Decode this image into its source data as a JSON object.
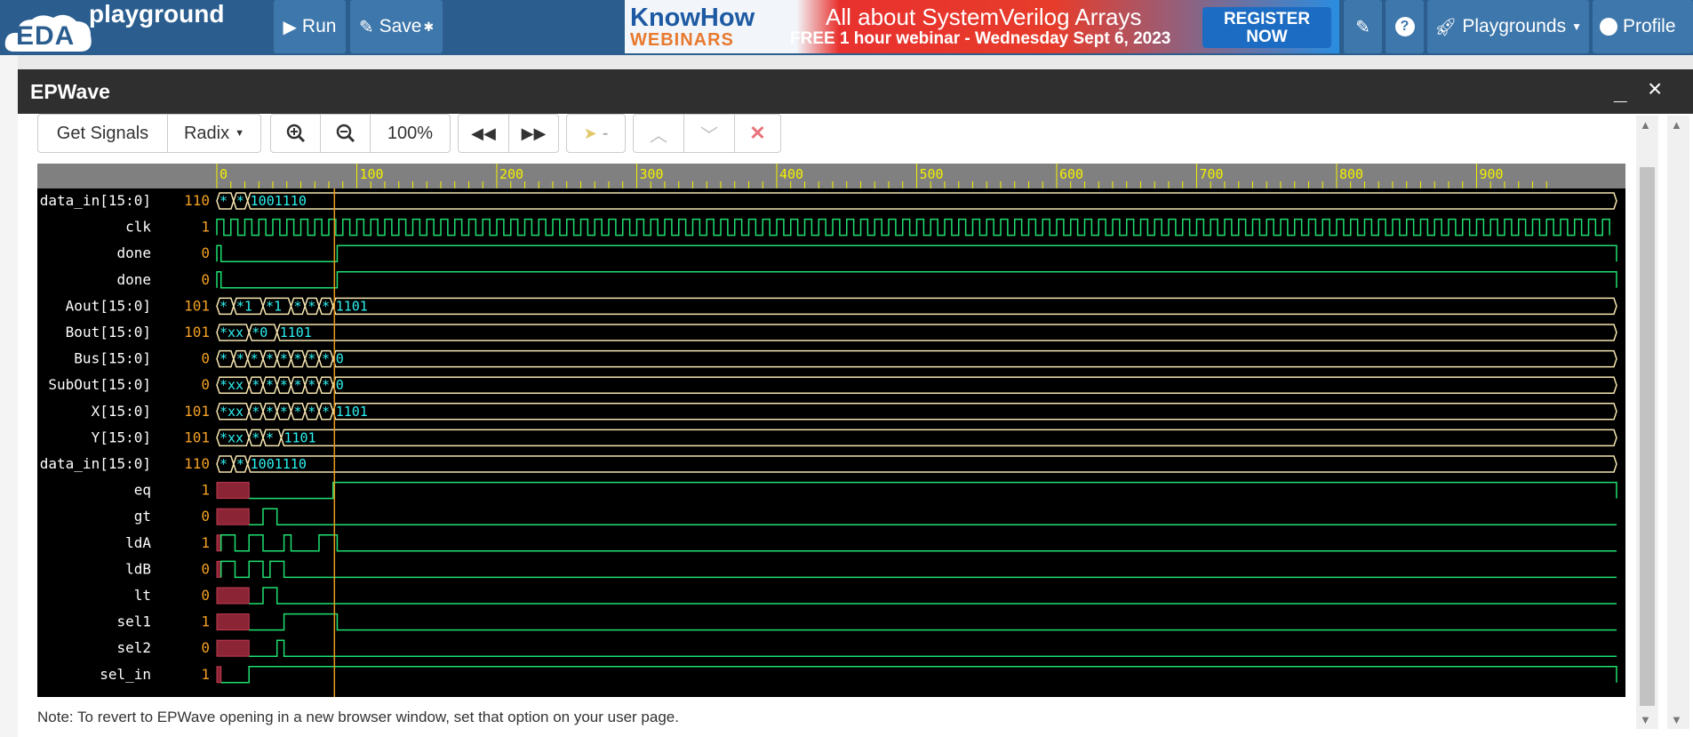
{
  "navbar": {
    "logo_eda": "EDA",
    "logo_playground": "playground",
    "run_label": "Run",
    "save_label": "Save",
    "save_marker": "✱",
    "playgrounds_label": "Playgrounds",
    "profile_label": "Profile"
  },
  "banner": {
    "brand_line1": "KnowHow",
    "brand_line2": "WEBINARS",
    "headline": "All about SystemVerilog Arrays",
    "subline": "FREE 1 hour webinar - Wednesday Sept 6, 2023",
    "cta_line1": "REGISTER",
    "cta_line2": "NOW"
  },
  "modal": {
    "title": "EPWave",
    "minimize": "_",
    "close": "×"
  },
  "toolbar": {
    "get_signals": "Get Signals",
    "radix": "Radix",
    "zoom_level": "100%",
    "cursor_value": "-"
  },
  "timeline": {
    "ticks": [
      "0",
      "100",
      "200",
      "300",
      "400",
      "500",
      "600",
      "700",
      "800",
      "900"
    ]
  },
  "signals": [
    {
      "name": "data_in[15:0]",
      "value": "110",
      "type": "bus",
      "segs": [
        [
          "*",
          0,
          12
        ],
        [
          "*",
          12,
          22
        ],
        [
          "1001110",
          22,
          1000
        ]
      ]
    },
    {
      "name": "clk",
      "value": "1",
      "type": "clk"
    },
    {
      "name": "done",
      "value": "0",
      "type": "bit",
      "high": [
        [
          0,
          3
        ],
        [
          86,
          1000
        ]
      ]
    },
    {
      "name": "done",
      "value": "0",
      "type": "bit",
      "high": [
        [
          0,
          3
        ],
        [
          86,
          1000
        ]
      ]
    },
    {
      "name": "Aout[15:0]",
      "value": "101",
      "type": "bus",
      "segs": [
        [
          "*",
          0,
          12
        ],
        [
          "*1",
          12,
          33
        ],
        [
          "*1",
          33,
          53
        ],
        [
          "*",
          53,
          63
        ],
        [
          "*",
          63,
          73
        ],
        [
          "*",
          73,
          83
        ],
        [
          "1101",
          83,
          1000
        ]
      ]
    },
    {
      "name": "Bout[15:0]",
      "value": "101",
      "type": "bus",
      "segs": [
        [
          "*xx",
          0,
          23
        ],
        [
          "*0",
          23,
          43
        ],
        [
          "1101",
          43,
          1000
        ]
      ]
    },
    {
      "name": "Bus[15:0]",
      "value": "0",
      "type": "bus",
      "segs": [
        [
          "*",
          0,
          12
        ],
        [
          "*",
          12,
          22
        ],
        [
          "*",
          22,
          33
        ],
        [
          "*",
          33,
          43
        ],
        [
          "*",
          43,
          53
        ],
        [
          "*",
          53,
          63
        ],
        [
          "*",
          63,
          73
        ],
        [
          "*",
          73,
          83
        ],
        [
          "0",
          83,
          1000
        ]
      ]
    },
    {
      "name": "SubOut[15:0]",
      "value": "0",
      "type": "bus",
      "segs": [
        [
          "*xx",
          0,
          23
        ],
        [
          "*",
          23,
          33
        ],
        [
          "*",
          33,
          43
        ],
        [
          "*",
          43,
          53
        ],
        [
          "*",
          53,
          63
        ],
        [
          "*",
          63,
          73
        ],
        [
          "*",
          73,
          83
        ],
        [
          "0",
          83,
          1000
        ]
      ]
    },
    {
      "name": "X[15:0]",
      "value": "101",
      "type": "bus",
      "segs": [
        [
          "*xx",
          0,
          23
        ],
        [
          "*",
          23,
          33
        ],
        [
          "*",
          33,
          43
        ],
        [
          "*",
          43,
          53
        ],
        [
          "*",
          53,
          63
        ],
        [
          "*",
          63,
          73
        ],
        [
          "*",
          73,
          83
        ],
        [
          "1101",
          83,
          1000
        ]
      ]
    },
    {
      "name": "Y[15:0]",
      "value": "101",
      "type": "bus",
      "segs": [
        [
          "*xx",
          0,
          23
        ],
        [
          "*",
          23,
          33
        ],
        [
          "*",
          33,
          46
        ],
        [
          "1101",
          46,
          1000
        ]
      ]
    },
    {
      "name": "data_in[15:0]",
      "value": "110",
      "type": "bus",
      "segs": [
        [
          "*",
          0,
          12
        ],
        [
          "*",
          12,
          22
        ],
        [
          "1001110",
          22,
          1000
        ]
      ]
    },
    {
      "name": "eq",
      "value": "1",
      "type": "bit",
      "x": [
        0,
        23
      ],
      "high": [
        [
          83,
          1000
        ]
      ],
      "midx": [
        [
          23,
          83
        ]
      ]
    },
    {
      "name": "gt",
      "value": "0",
      "type": "bit",
      "x": [
        0,
        23
      ],
      "high": [
        [
          33,
          43
        ]
      ]
    },
    {
      "name": "ldA",
      "value": "1",
      "type": "bit",
      "x": [
        0,
        3
      ],
      "high": [
        [
          3,
          13
        ],
        [
          23,
          33
        ],
        [
          48,
          53
        ],
        [
          73,
          86
        ]
      ]
    },
    {
      "name": "ldB",
      "value": "0",
      "type": "bit",
      "x": [
        0,
        3
      ],
      "high": [
        [
          3,
          13
        ],
        [
          23,
          33
        ],
        [
          38,
          48
        ]
      ]
    },
    {
      "name": "lt",
      "value": "0",
      "type": "bit",
      "x": [
        0,
        23
      ],
      "high": [
        [
          33,
          43
        ]
      ]
    },
    {
      "name": "sel1",
      "value": "1",
      "type": "bit",
      "x": [
        0,
        23
      ],
      "high": [
        [
          48,
          86
        ]
      ]
    },
    {
      "name": "sel2",
      "value": "0",
      "type": "bit",
      "x": [
        0,
        23
      ],
      "high": [
        [
          43,
          48
        ]
      ]
    },
    {
      "name": "sel_in",
      "value": "1",
      "type": "bit",
      "x": [
        0,
        3
      ],
      "high": [
        [
          23,
          1000
        ]
      ]
    }
  ],
  "cursor_time": 84,
  "footer_note": "Note: To revert to EPWave opening in a new browser window, set that option on your user page."
}
